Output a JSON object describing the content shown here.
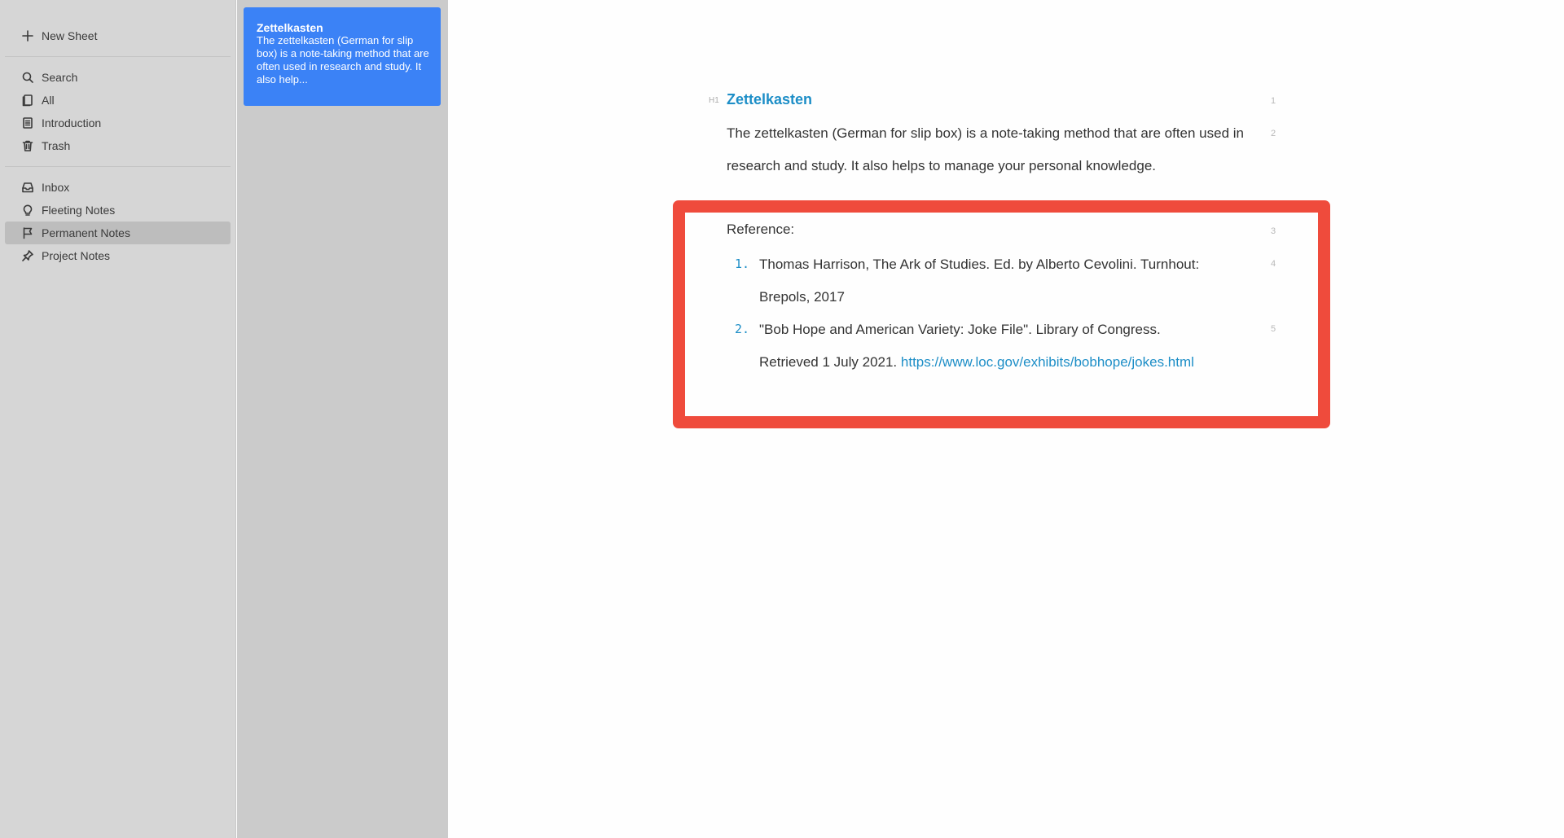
{
  "sidebar": {
    "new_sheet": "New Sheet",
    "library": [
      {
        "label": "Search",
        "icon": "search-icon"
      },
      {
        "label": "All",
        "icon": "sheets-icon"
      },
      {
        "label": "Introduction",
        "icon": "document-icon"
      },
      {
        "label": "Trash",
        "icon": "trash-icon"
      }
    ],
    "groups": [
      {
        "label": "Inbox",
        "icon": "inbox-icon"
      },
      {
        "label": "Fleeting Notes",
        "icon": "lightbulb-icon"
      },
      {
        "label": "Permanent Notes",
        "icon": "flag-icon",
        "active": true
      },
      {
        "label": "Project Notes",
        "icon": "pin-icon"
      }
    ]
  },
  "sheet_list": {
    "card": {
      "title": "Zettelkasten",
      "excerpt": "The zettelkasten (German for slip box) is a note-taking method that are often used in research and study. It also help..."
    }
  },
  "editor": {
    "h1_marker": "H1",
    "heading": "Zettelkasten",
    "paragraph": "The zettelkasten (German for slip box) is a note-taking method that are often used in research and study. It also helps to manage your personal knowledge.",
    "reference_label": "Reference:",
    "references": [
      {
        "num": "1.",
        "line1": " Thomas Harrison, The Ark of Studies. Ed. by Alberto Cevolini. Turnhout:",
        "line2": "Brepols, 2017"
      },
      {
        "num": "2.",
        "line1": "\"Bob Hope and American Variety: Joke File\". Library of Congress.",
        "line2_text": "Retrieved 1 July 2021. ",
        "line2_link": "https://www.loc.gov/exhibits/bobhope/jokes.html"
      }
    ],
    "line_numbers": [
      "1",
      "2",
      "3",
      "4",
      "5"
    ]
  },
  "colors": {
    "accent": "#1d8ec7",
    "card_blue": "#3b82f6",
    "highlight": "#ef4b3c",
    "sidebar_bg": "#d6d6d6"
  }
}
